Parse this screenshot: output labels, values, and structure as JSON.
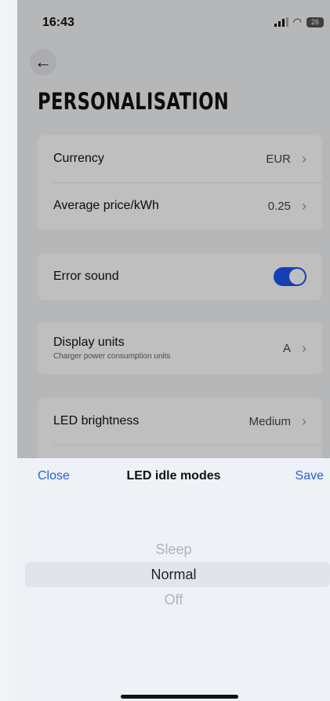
{
  "status_bar": {
    "time": "16:43",
    "battery": "26"
  },
  "page": {
    "title": "PERSONALISATION",
    "back_icon": "back-arrow-icon"
  },
  "settings": {
    "currency": {
      "label": "Currency",
      "value": "EUR"
    },
    "average_price": {
      "label": "Average price/kWh",
      "value": "0.25"
    },
    "error_sound": {
      "label": "Error sound",
      "enabled": true
    },
    "display_units": {
      "label": "Display units",
      "sublabel": "Charger power consumption units",
      "value": "A"
    },
    "led_brightness": {
      "label": "LED brightness",
      "value": "Medium"
    }
  },
  "sheet": {
    "close_label": "Close",
    "title": "LED idle modes",
    "save_label": "Save",
    "options": [
      "Sleep",
      "Normal",
      "Off"
    ],
    "selected": "Normal"
  },
  "colors": {
    "accent": "#2461d6",
    "toggle_on": "#1e55f0"
  }
}
